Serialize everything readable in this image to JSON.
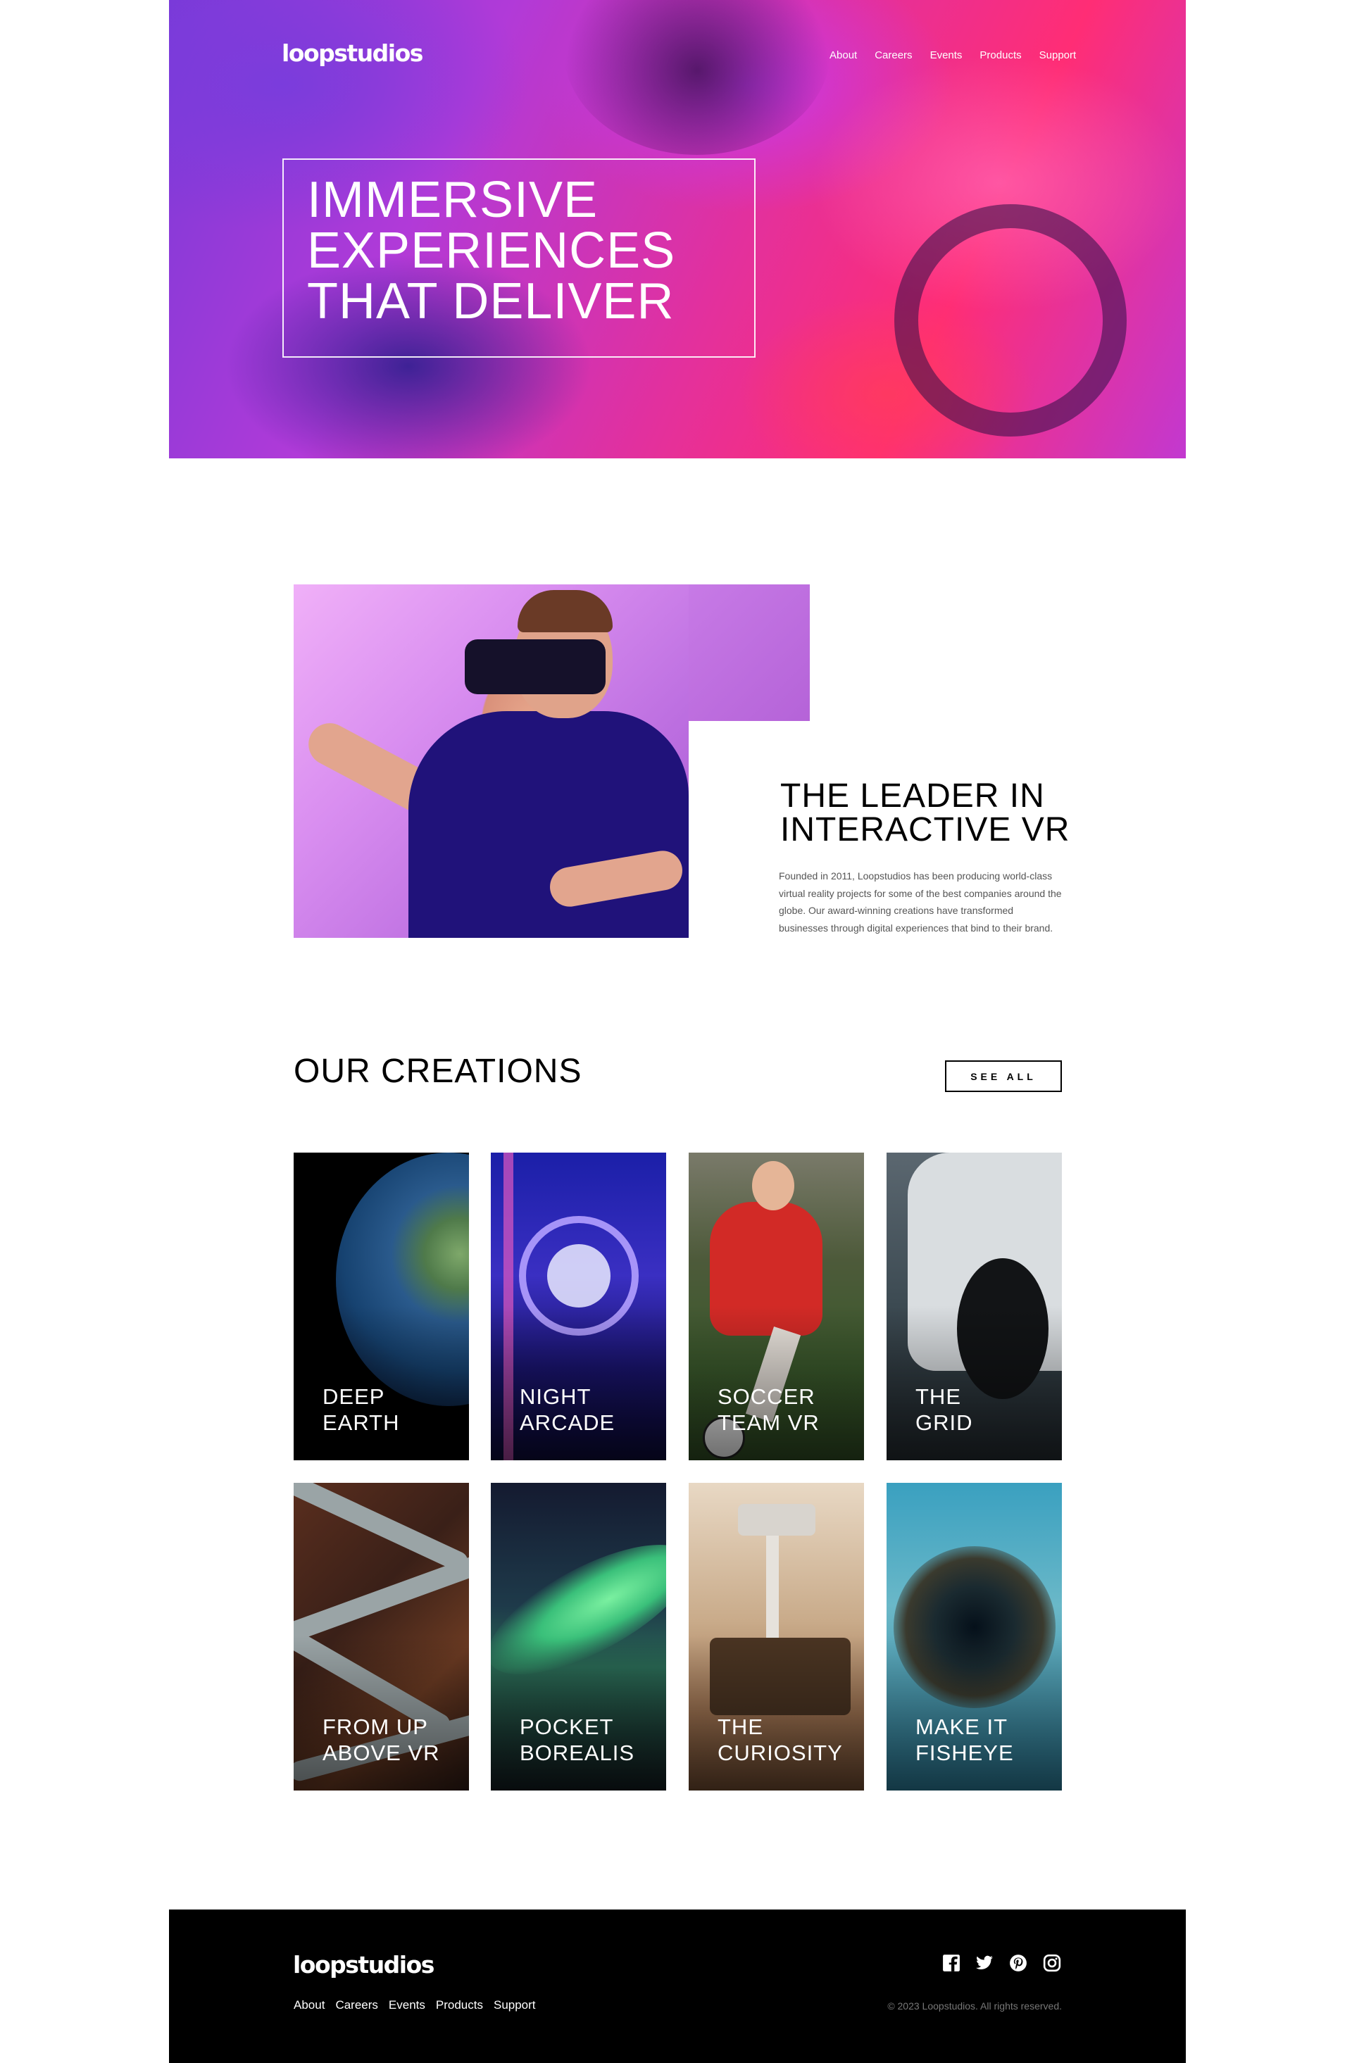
{
  "brand": {
    "logo": "loopstudios"
  },
  "header": {
    "nav": [
      "About",
      "Careers",
      "Events",
      "Products",
      "Support"
    ]
  },
  "hero": {
    "title_lines": [
      "IMMERSIVE",
      "EXPERIENCES",
      "THAT DELIVER"
    ]
  },
  "intro": {
    "title_lines": [
      "THE LEADER IN",
      "INTERACTIVE VR"
    ],
    "text": "Founded in 2011, Loopstudios has been producing world-class virtual reality projects for some of the best companies around the globe. Our award-winning creations have transformed businesses through digital experiences that bind to their brand."
  },
  "creations": {
    "title": "OUR CREATIONS",
    "see_all": "SEE ALL",
    "items": [
      {
        "label": "DEEP\nEARTH",
        "icon": "earth-image"
      },
      {
        "label": "NIGHT\nARCADE",
        "icon": "arcade-image"
      },
      {
        "label": "SOCCER\nTEAM VR",
        "icon": "soccer-image"
      },
      {
        "label": "THE\nGRID",
        "icon": "car-image"
      },
      {
        "label": "FROM UP\nABOVE VR",
        "icon": "roads-image"
      },
      {
        "label": "POCKET\nBOREALIS",
        "icon": "aurora-image"
      },
      {
        "label": "THE\nCURIOSITY",
        "icon": "rover-image"
      },
      {
        "label": "MAKE IT\nFISHEYE",
        "icon": "fisheye-image"
      }
    ]
  },
  "footer": {
    "nav": [
      "About",
      "Careers",
      "Events",
      "Products",
      "Support"
    ],
    "social": [
      "facebook-icon",
      "twitter-icon",
      "pinterest-icon",
      "instagram-icon"
    ],
    "copyright": "© 2023 Loopstudios. All rights reserved."
  },
  "colors": {
    "hero_accent": "#d93ab0",
    "text_dark": "#000000",
    "text_muted": "#555555",
    "footer_bg": "#000000"
  }
}
